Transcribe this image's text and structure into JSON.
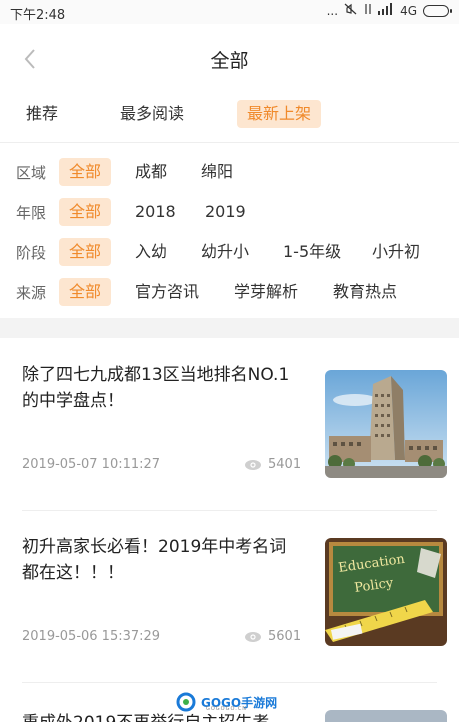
{
  "status_bar": {
    "time": "下午2:48",
    "network": "4G",
    "signal_text": "..."
  },
  "header": {
    "title": "全部"
  },
  "tabs": [
    {
      "label": "推荐",
      "active": false
    },
    {
      "label": "最多阅读",
      "active": false
    },
    {
      "label": "最新上架",
      "active": true
    }
  ],
  "filters": {
    "region": {
      "label": "区域",
      "options": [
        "全部",
        "成都",
        "绵阳"
      ],
      "selected": "全部"
    },
    "year": {
      "label": "年限",
      "options": [
        "全部",
        "2018",
        "2019"
      ],
      "selected": "全部"
    },
    "stage": {
      "label": "阶段",
      "options": [
        "全部",
        "入幼",
        "幼升小",
        "1-5年级",
        "小升初"
      ],
      "selected": "全部"
    },
    "source": {
      "label": "来源",
      "options": [
        "全部",
        "官方咨讯",
        "学芽解析",
        "教育热点"
      ],
      "selected": "全部"
    }
  },
  "articles": [
    {
      "title": "除了四七九成都13区当地排名NO.1的中学盘点！",
      "date": "2019-05-07 10:11:27",
      "views": "5401",
      "thumb_icon": "school-building-image"
    },
    {
      "title": "初升高家长必看！2019年中考名词都在这！！！",
      "date": "2019-05-06 15:37:29",
      "views": "5601",
      "thumb_icon": "education-policy-chalkboard-image",
      "thumb_text_1": "Education",
      "thumb_text_2": "Policy"
    },
    {
      "title": "重成外2019不再举行自主招生考",
      "partial": true
    }
  ],
  "watermark": {
    "text": "GOGO手游网",
    "sub": "GOGOGO.CN"
  },
  "colors": {
    "accent": "#f08a2b",
    "accent_bg": "#fde6d0",
    "text": "#333333",
    "muted": "#999999"
  }
}
